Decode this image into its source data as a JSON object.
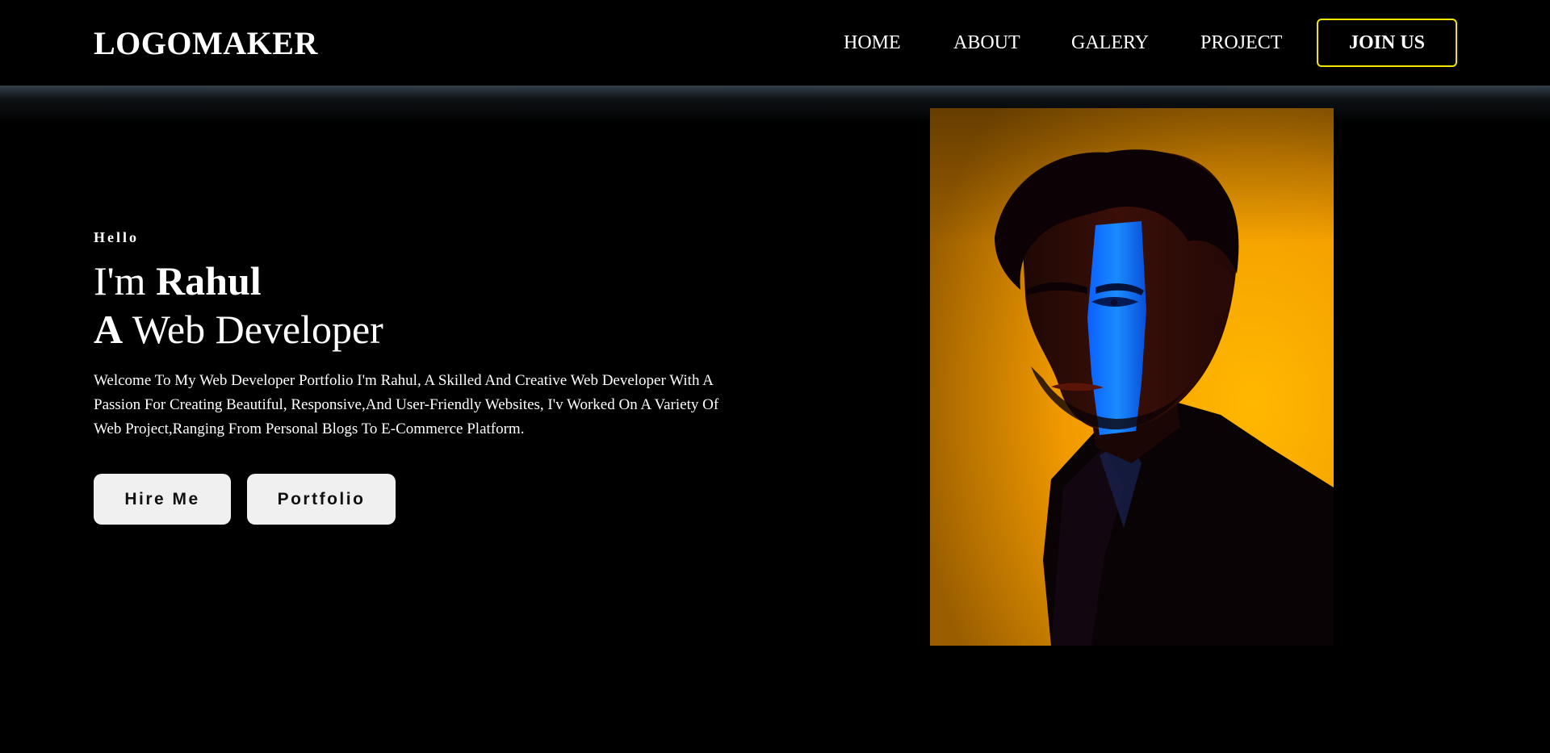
{
  "header": {
    "logo": "LOGOMAKER",
    "nav": [
      "HOME",
      "ABOUT",
      "GALERY",
      "PROJECT"
    ],
    "cta_label": "JOIN US",
    "cta_border_color": "#f2e600"
  },
  "hero": {
    "greeting": "Hello",
    "headline_prefix": "I'm ",
    "name": "Rahul",
    "role_article": "A",
    "role": " Web Developer",
    "intro": "Welcome To My Web Developer Portfolio I'm Rahul, A Skilled And Creative Web Developer With A Passion For Creating Beautiful, Responsive,And User-Friendly Websites, I'v Worked On A Variety Of Web Project,Ranging From Personal Blogs To E-Commerce Platform.",
    "buttons": {
      "hire": "Hire Me",
      "portfolio": "Portfolio"
    }
  },
  "portrait": {
    "icon": "portrait-photo",
    "background_color": "#f4a100",
    "accent_light_color": "#0a6cff"
  }
}
